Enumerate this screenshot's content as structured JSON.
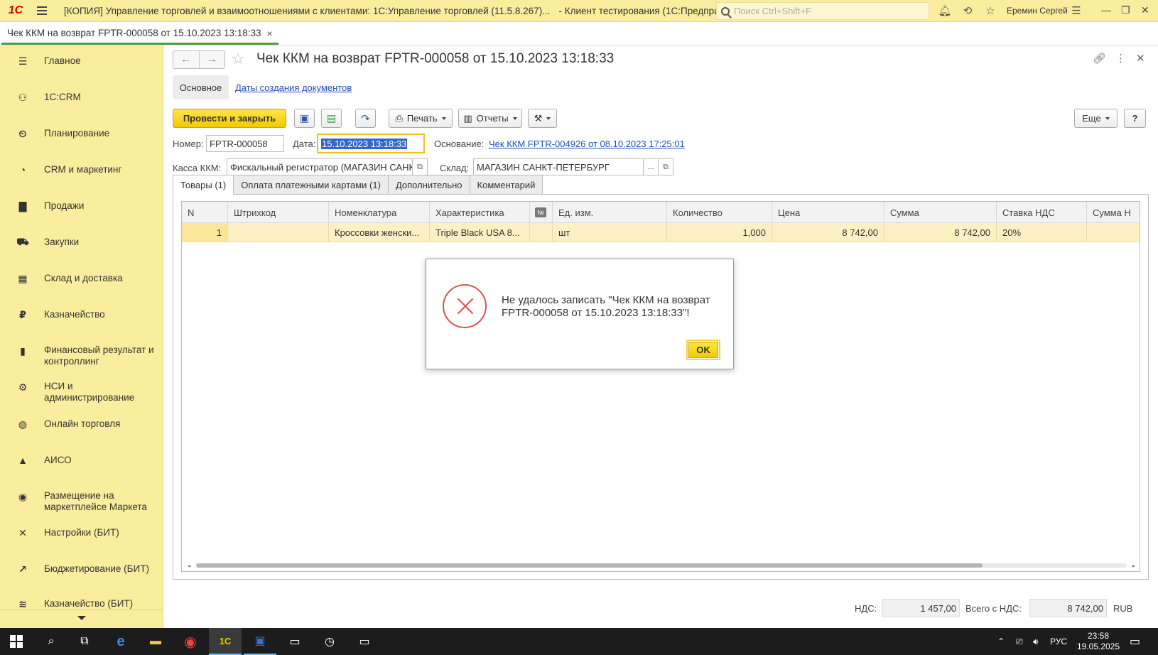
{
  "titlebar": {
    "logo": "1С",
    "app_title": "[КОПИЯ] Управление торговлей и взаимоотношениями с клиентами: 1С:Управление торговлей (11.5.8.267)...",
    "app_title2": "- Клиент тестирования (1С:Предприятие)",
    "search_placeholder": "Поиск Ctrl+Shift+F",
    "user": "Еремин Сергей"
  },
  "doc_tab": {
    "label": "Чек ККМ на возврат FPTR-000058 от 15.10.2023 13:18:33",
    "close": "×"
  },
  "sidebar": {
    "items": [
      {
        "label": "Главное",
        "icon": "menu-icon"
      },
      {
        "label": "1С:CRM",
        "icon": "crm-icon"
      },
      {
        "label": "Планирование",
        "icon": "planning-icon"
      },
      {
        "label": "CRM и маркетинг",
        "icon": "pie-chart-icon"
      },
      {
        "label": "Продажи",
        "icon": "bag-icon"
      },
      {
        "label": "Закупки",
        "icon": "cart-icon"
      },
      {
        "label": "Склад и доставка",
        "icon": "warehouse-icon"
      },
      {
        "label": "Казначейство",
        "icon": "ruble-icon"
      },
      {
        "label": "Финансовый результат и контроллинг",
        "icon": "bar-chart-icon"
      },
      {
        "label": "НСИ и администрирование",
        "icon": "gear-icon"
      },
      {
        "label": "Онлайн торговля",
        "icon": "globe-icon"
      },
      {
        "label": "АИСО",
        "icon": "aiso-icon"
      },
      {
        "label": "Размещение на маркетплейсе Маркета",
        "icon": "market-icon"
      },
      {
        "label": "Настройки (БИТ)",
        "icon": "tools-icon"
      },
      {
        "label": "Бюджетирование (БИТ)",
        "icon": "budget-icon"
      },
      {
        "label": "Казначейство (БИТ)",
        "icon": "treasury-icon"
      }
    ]
  },
  "document": {
    "title": "Чек ККМ на возврат FPTR-000058 от 15.10.2023 13:18:33",
    "subtab_main": "Основное",
    "subtab_link": "Даты создания документов",
    "toolbar": {
      "post_close": "Провести и закрыть",
      "print": "Печать",
      "reports": "Отчеты",
      "more": "Еще",
      "help": "?"
    },
    "fields": {
      "number_label": "Номер:",
      "number_value": "FPTR-000058",
      "date_label": "Дата:",
      "date_value": "15.10.2023 13:18:33",
      "basis_label": "Основание:",
      "basis_link": "Чек ККМ FPTR-004926 от 08.10.2023 17:25:01",
      "kassa_label": "Касса ККМ:",
      "kassa_value": "Фискальный регистратор (МАГАЗИН САНКТ",
      "sklad_label": "Склад:",
      "sklad_value": "МАГАЗИН САНКТ-ПЕТЕРБУРГ",
      "ellipsis": "..."
    },
    "tabs": [
      "Товары (1)",
      "Оплата платежными картами (1)",
      "Дополнительно",
      "Комментарий"
    ],
    "table": {
      "columns": [
        "N",
        "Штрихкод",
        "Номенклатура",
        "Характеристика",
        "№",
        "Ед. изм.",
        "Количество",
        "Цена",
        "Сумма",
        "Ставка НДС",
        "Сумма Н"
      ],
      "rows": [
        [
          "1",
          "",
          "Кроссовки женски...",
          "Triple Black USA 8...",
          "",
          "шт",
          "1,000",
          "8 742,00",
          "8 742,00",
          "20%",
          ""
        ]
      ]
    },
    "totals": {
      "vat_label": "НДС:",
      "vat_value": "1 457,00",
      "total_label": "Всего с НДС:",
      "total_value": "8 742,00",
      "currency": "RUB"
    }
  },
  "dialog": {
    "message": "Не удалось записать \"Чек ККМ на возврат FPTR-000058 от 15.10.2023 13:18:33\"!",
    "ok": "OK"
  },
  "taskbar": {
    "lang": "РУС",
    "time": "23:58",
    "date": "19.05.2025"
  }
}
